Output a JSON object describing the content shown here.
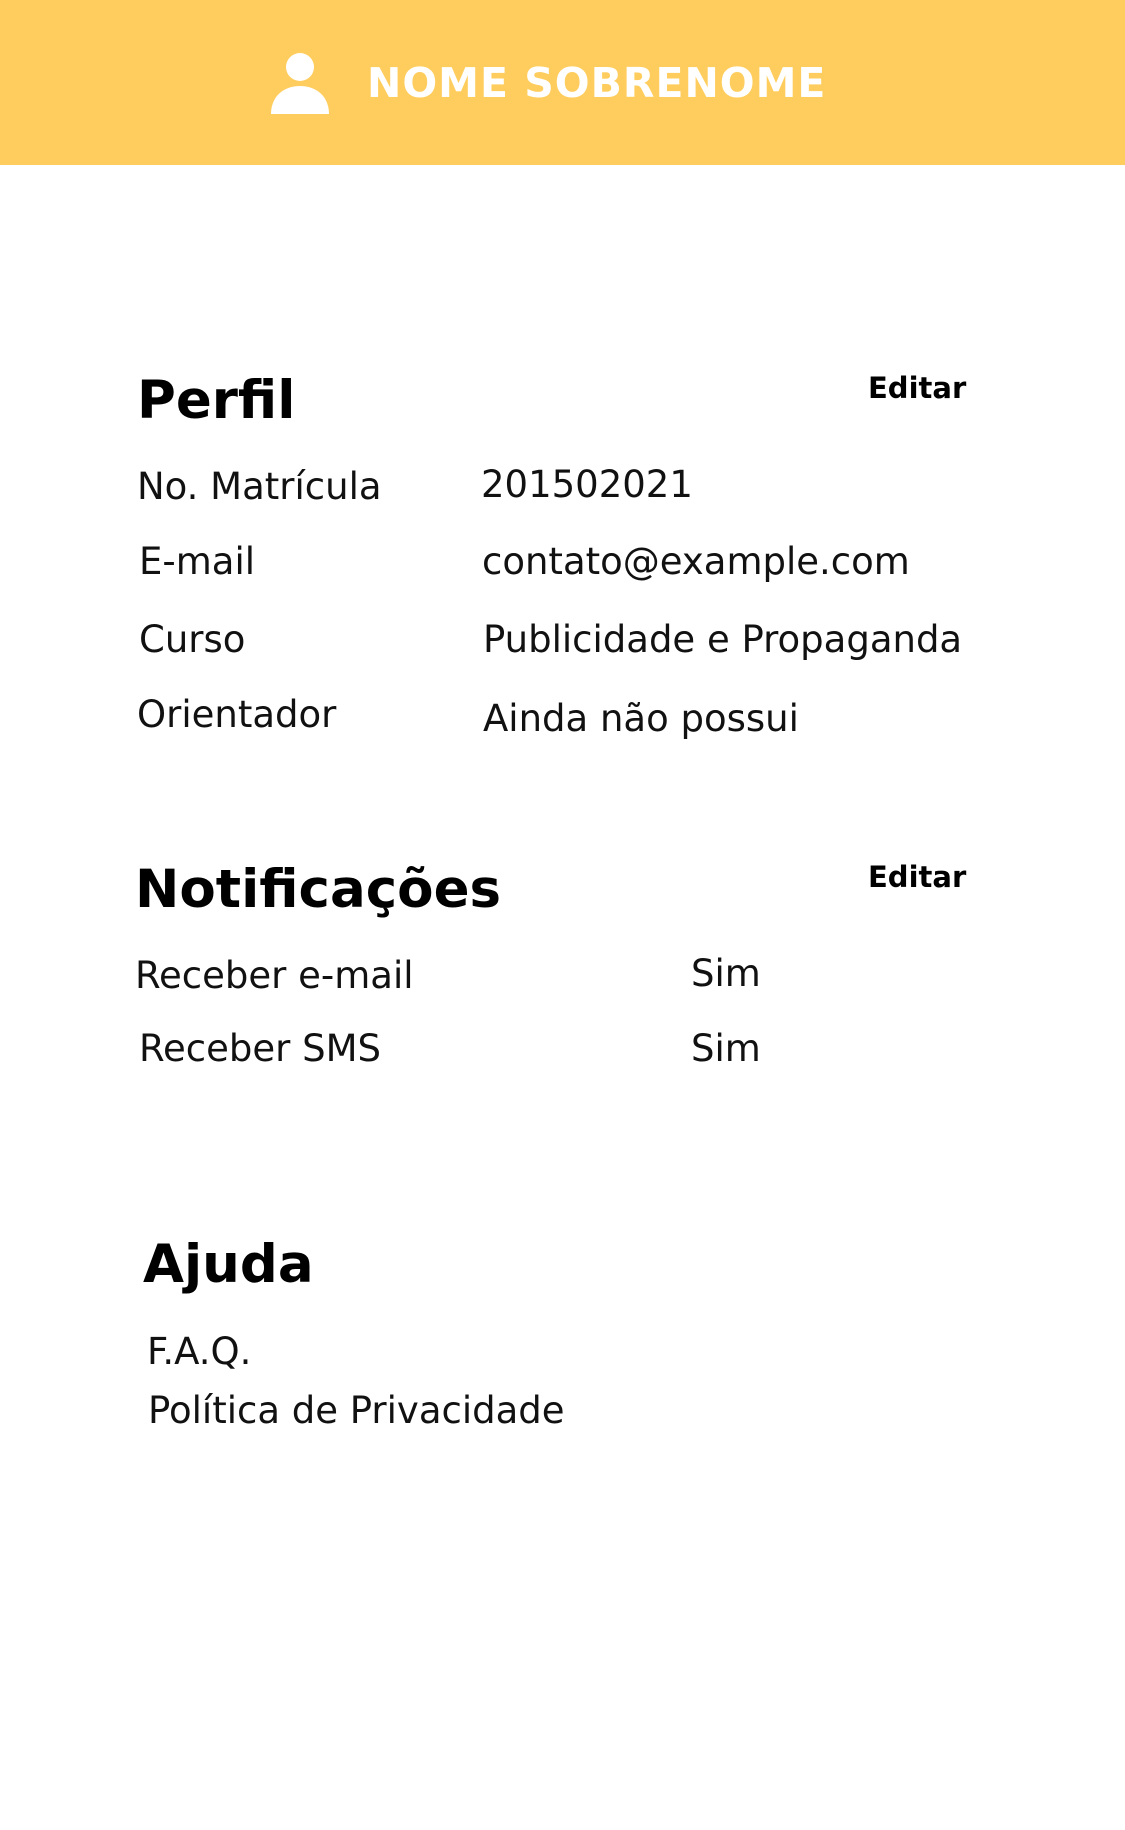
{
  "header": {
    "user_name": "NOME SOBRENOME",
    "icon": "user-icon",
    "background_color": "#FFCD5D",
    "text_color": "#FFFFFF"
  },
  "profile": {
    "title": "Perfil",
    "edit_label": "Editar",
    "rows": [
      {
        "label": "No. Matrícula",
        "value": "201502021"
      },
      {
        "label": "E-mail",
        "value": "contato@example.com"
      },
      {
        "label": "Curso",
        "value": "Publicidade e Propaganda"
      },
      {
        "label": "Orientador",
        "value": "Ainda não possui"
      }
    ]
  },
  "notifications": {
    "title": "Notificações",
    "edit_label": "Editar",
    "rows": [
      {
        "label": "Receber e-mail",
        "value": "Sim"
      },
      {
        "label": "Receber SMS",
        "value": "Sim"
      }
    ]
  },
  "help": {
    "title": "Ajuda",
    "links": [
      {
        "label": "F.A.Q."
      },
      {
        "label": "Política de Privacidade"
      }
    ]
  }
}
